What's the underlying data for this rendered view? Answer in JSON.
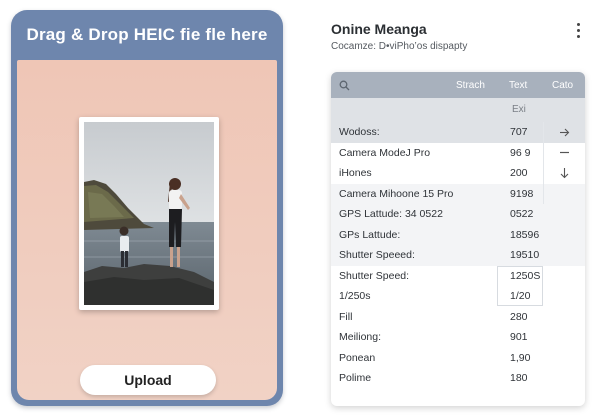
{
  "dropzone": {
    "header": "Drag & Drop HEIC fie fle here",
    "upload_label": "Upload"
  },
  "panel": {
    "title": "Onine Meanga",
    "subtitle": "Cocamze: D•viPho’os dispapty"
  },
  "table": {
    "toolbar": {
      "search_icon": "search-icon",
      "tabs": [
        "Strach",
        "Text",
        "Cato"
      ]
    },
    "subheader": "Exi",
    "rows": [
      {
        "label": "Wodoss:",
        "value": "707"
      },
      {
        "label": "Camera ModeJ Pro",
        "value": "96 9"
      },
      {
        "label": "iHones",
        "value": "200"
      },
      {
        "label": "Camera Mihoone 15 Pro",
        "value": "9198"
      },
      {
        "label": "GPS Lattude: 34 0522",
        "value": "0522"
      },
      {
        "label": "GPs Lattude:",
        "value": "18596"
      },
      {
        "label": "Shutter Speeed:",
        "value": "19510"
      },
      {
        "label": "Shutter Speed:",
        "value": "1250S"
      },
      {
        "label": "1/250s",
        "value": "1/20"
      },
      {
        "label": "Fill",
        "value": "280"
      },
      {
        "label": "Meiliong:",
        "value": "901"
      },
      {
        "label": "Ponean",
        "value": "1,90"
      },
      {
        "label": "Polime",
        "value": "180"
      }
    ],
    "side_actions": [
      "arrow-right-icon",
      "minus-icon",
      "arrow-down-icon"
    ]
  },
  "colors": {
    "card_frame": "#6e86ad",
    "drop_area": "#efc6b6",
    "toolbar": "#a8b1bd",
    "selected_row": "#dfe2e6"
  }
}
